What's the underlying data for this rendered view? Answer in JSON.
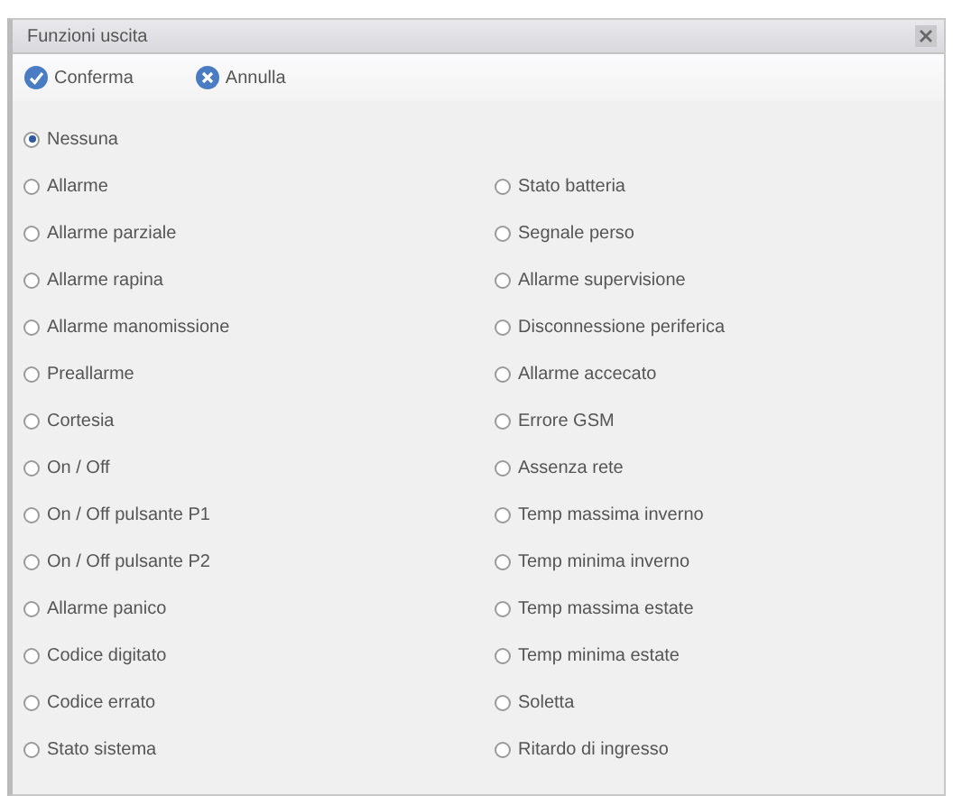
{
  "window": {
    "title": "Funzioni uscita"
  },
  "toolbar": [
    {
      "kind": "confirm",
      "label": "Conferma"
    },
    {
      "kind": "cancel",
      "label": "Annulla"
    }
  ],
  "options": [
    {
      "label": "Nessuna",
      "selected": true
    }
  ],
  "columns": [
    [
      {
        "label": "Allarme",
        "selected": false
      },
      {
        "label": "Allarme parziale",
        "selected": false
      },
      {
        "label": "Allarme rapina",
        "selected": false
      },
      {
        "label": "Allarme manomissione",
        "selected": false
      },
      {
        "label": "Preallarme",
        "selected": false
      },
      {
        "label": "Cortesia",
        "selected": false
      },
      {
        "label": "On / Off",
        "selected": false
      },
      {
        "label": "On / Off pulsante P1",
        "selected": false
      },
      {
        "label": "On / Off pulsante P2",
        "selected": false
      },
      {
        "label": "Allarme panico",
        "selected": false
      },
      {
        "label": "Codice digitato",
        "selected": false
      },
      {
        "label": "Codice errato",
        "selected": false
      },
      {
        "label": "Stato sistema",
        "selected": false
      }
    ],
    [
      {
        "label": "Stato batteria",
        "selected": false
      },
      {
        "label": "Segnale perso",
        "selected": false
      },
      {
        "label": "Allarme supervisione",
        "selected": false
      },
      {
        "label": "Disconnessione periferica",
        "selected": false
      },
      {
        "label": "Allarme accecato",
        "selected": false
      },
      {
        "label": "Errore GSM",
        "selected": false
      },
      {
        "label": "Assenza rete",
        "selected": false
      },
      {
        "label": "Temp massima inverno",
        "selected": false
      },
      {
        "label": "Temp minima inverno",
        "selected": false
      },
      {
        "label": "Temp massima estate",
        "selected": false
      },
      {
        "label": "Temp minima estate",
        "selected": false
      },
      {
        "label": "Soletta",
        "selected": false
      },
      {
        "label": "Ritardo di ingresso",
        "selected": false
      }
    ]
  ]
}
